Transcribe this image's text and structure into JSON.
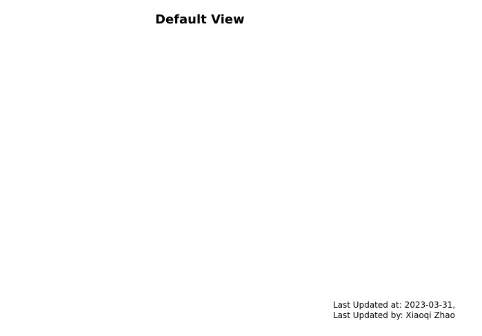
{
  "view": {
    "title": "Default View"
  },
  "footer": {
    "updated_at_label": "Last Updated at:",
    "updated_at_value": "2023-03-31,",
    "updated_by_label": "Last Updated by:",
    "updated_by_value": "Xiaoqi Zhao"
  }
}
